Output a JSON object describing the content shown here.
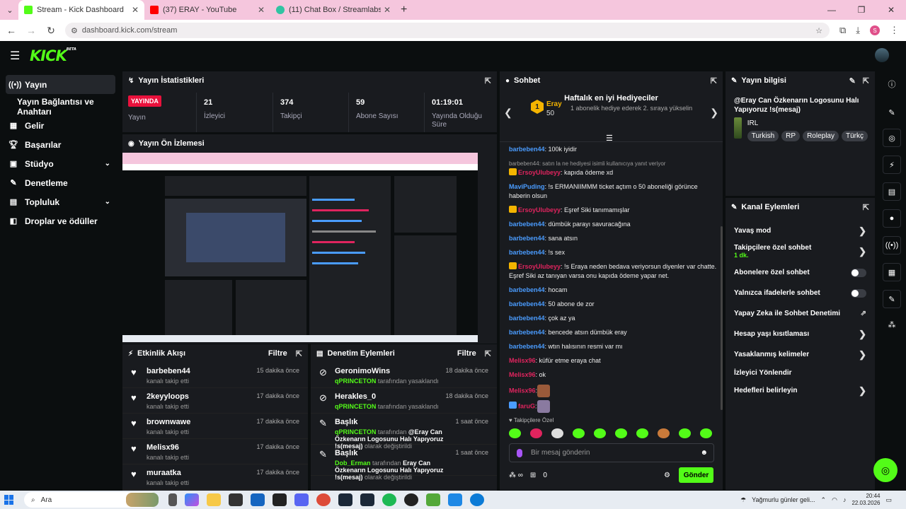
{
  "browser": {
    "tabs": [
      {
        "title": "Stream - Kick Dashboard",
        "color": "#53fc18"
      },
      {
        "title": "(37) ERAY - YouTube",
        "color": "#ff0000"
      },
      {
        "title": "(11) Chat Box / Streamlabs",
        "color": "#31c3a2"
      }
    ],
    "url": "dashboard.kick.com/stream",
    "profile_initial": "S"
  },
  "app": {
    "logo": "KICK",
    "logo_badge": "BETA"
  },
  "sidebar": {
    "items": [
      {
        "label": "Yayın"
      },
      {
        "label": "Yayın Bağlantısı ve Anahtarı"
      },
      {
        "label": "Gelir"
      },
      {
        "label": "Başarılar"
      },
      {
        "label": "Stüdyo"
      },
      {
        "label": "Denetleme"
      },
      {
        "label": "Topluluk"
      },
      {
        "label": "Droplar ve ödüller"
      }
    ]
  },
  "stats": {
    "title": "Yayın İstatistikleri",
    "live": "YAYINDA",
    "status_label": "Yayın",
    "items": [
      {
        "value": "21",
        "label": "İzleyici"
      },
      {
        "value": "374",
        "label": "Takipçi"
      },
      {
        "value": "59",
        "label": "Abone Sayısı"
      },
      {
        "value": "01:19:01",
        "label": "Yayında Olduğu Süre"
      }
    ]
  },
  "preview": {
    "title": "Yayın Ön İzlemesi"
  },
  "activity": {
    "title": "Etkinlik Akışı",
    "filter": "Filtre",
    "items": [
      {
        "name": "barbeben44",
        "desc": "kanalı takip etti",
        "time": "15 dakika önce"
      },
      {
        "name": "2keyyloops",
        "desc": "kanalı takip etti",
        "time": "17 dakika önce"
      },
      {
        "name": "brownwawe",
        "desc": "kanalı takip etti",
        "time": "17 dakika önce"
      },
      {
        "name": "Melisx96",
        "desc": "kanalı takip etti",
        "time": "17 dakika önce"
      },
      {
        "name": "muraatka",
        "desc": "kanalı takip etti",
        "time": "17 dakika önce"
      }
    ]
  },
  "moderation": {
    "title": "Denetim Eylemleri",
    "filter": "Filtre",
    "items": [
      {
        "name": "GeronimoWins",
        "by": "qPRINCETON",
        "rest": "tarafından yasaklandı",
        "time": "18 dakika önce"
      },
      {
        "name": "Herakles_0",
        "by": "qPRINCETON",
        "rest": "tarafından yasaklandı",
        "time": "18 dakika önce"
      },
      {
        "name": "Başlık",
        "by": "qPRINCETON",
        "rest": "tarafından",
        "bold": "@Eray Can Özkenarın Logosunu Halı Yapıyoruz !s(mesaj)",
        "tail": "olarak değiştirildi",
        "time": "1 saat önce"
      },
      {
        "name": "Başlık",
        "by": "Dob_Erman",
        "rest": "tarafından",
        "bold": "Eray Can Özkenarın Logosunu Halı Yapıyoruz !s(mesaj)",
        "tail": "olarak değiştirildi",
        "time": "1 saat önce"
      }
    ]
  },
  "chat": {
    "title": "Sohbet",
    "gifters_title": "Haftalık en iyi Hediyeciler",
    "gifter": {
      "rank": "1",
      "name": "Eray",
      "count": "50",
      "desc": "1 abonelik hediye ederek 2. sıraya yükselin"
    },
    "messages": [
      {
        "user": "barbeben44",
        "text": ": 100k iyidir"
      },
      {
        "reply": "barbeben44: satın la ne hediyesi isimli kullanıcıya yanıt veriyor",
        "user": "ErsoyUlubeyy",
        "text": ": kapıda ödeme xd"
      },
      {
        "user": "MaviPuding",
        "text": ": !s ERMANIIMMM ticket açtım o 50 aboneliği görünce haberin olsun"
      },
      {
        "user": "ErsoyUlubeyy",
        "text": ": Eşref Siki tanımamışlar"
      },
      {
        "user": "barbeben44",
        "text": ": dümbük parayı savuracağına"
      },
      {
        "user": "barbeben44",
        "text": ": sana atsın"
      },
      {
        "user": "barbeben44",
        "text": ": !s sex"
      },
      {
        "user": "ErsoyUlubeyy",
        "text": ": !s Eraya neden bedava veriyorsun diyenler var chatte. Eşref Siki az tanıyan varsa onu kapıda ödeme yapar net."
      },
      {
        "user": "barbeben44",
        "text": ": hocam"
      },
      {
        "user": "barbeben44",
        "text": ": 50 abone de zor"
      },
      {
        "user": "barbeben44",
        "text": ": çok az ya"
      },
      {
        "user": "barbeben44",
        "text": ": bencede atsın dümbük eray"
      },
      {
        "user": "barbeben44",
        "text": ": wtın halısının resmi var mı"
      },
      {
        "user": "Melisx96",
        "text": ": küfür etme eraya chat"
      },
      {
        "user": "Melisx96",
        "text": ": ok"
      },
      {
        "user": "Melisx96",
        "text": ":"
      },
      {
        "user": "faruG",
        "text": ":"
      }
    ],
    "followers_only": "Takipçilere Özel",
    "input_placeholder": "Bir mesaj gönderin",
    "points": "0",
    "send": "Gönder"
  },
  "stream_info": {
    "title_label": "Yayın bilgisi",
    "stream_title": "@Eray Can Özkenarın Logosunu Halı Yapıyoruz !s(mesaj)",
    "category": "IRL",
    "tags": [
      "Turkish",
      "RP",
      "Roleplay",
      "Türkç"
    ]
  },
  "channel_actions": {
    "title": "Kanal Eylemleri",
    "items": [
      {
        "label": "Yavaş mod",
        "type": "arrow"
      },
      {
        "label": "Takipçilere özel sohbet",
        "sub": "1 dk.",
        "type": "arrow"
      },
      {
        "label": "Abonelere özel sohbet",
        "type": "toggle"
      },
      {
        "label": "Yalnızca ifadelerle sohbet",
        "type": "toggle"
      },
      {
        "label": "Yapay Zeka ile Sohbet Denetimi",
        "type": "ext"
      },
      {
        "label": "Hesap yaşı kısıtlaması",
        "type": "arrow"
      },
      {
        "label": "Yasaklanmış kelimeler",
        "type": "arrow"
      },
      {
        "label": "İzleyici Yönlendir",
        "type": "none"
      },
      {
        "label": "Hedefleri belirleyin",
        "type": "arrow"
      }
    ]
  },
  "taskbar": {
    "search": "Ara",
    "weather": "Yağmurlu günler geli...",
    "time": "20:44",
    "date": "22.03.2026"
  }
}
